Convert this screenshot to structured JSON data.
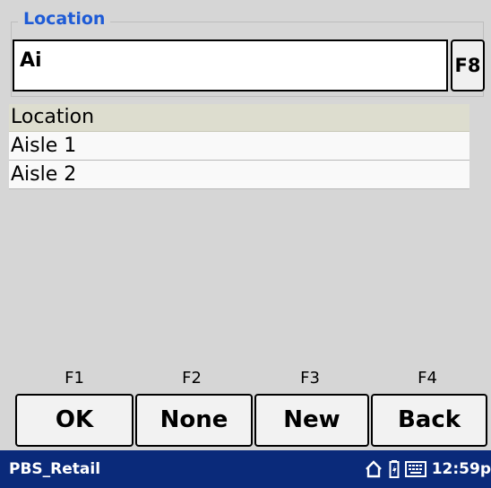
{
  "location_group": {
    "legend": "Location",
    "input_value": "Ai",
    "lookup_button": "F8"
  },
  "list": {
    "header": "Location",
    "items": [
      "Aisle 1",
      "Aisle 2"
    ]
  },
  "function_keys": {
    "labels": [
      "F1",
      "F2",
      "F3",
      "F4"
    ],
    "buttons": [
      "OK",
      "None",
      "New",
      "Back"
    ]
  },
  "taskbar": {
    "app_name": "PBS_Retail",
    "clock": "12:59p",
    "icons": [
      "home-icon",
      "battery-icon",
      "keyboard-icon"
    ],
    "background": "#0a2a7a"
  },
  "colors": {
    "accent": "#1e5bd6",
    "list_header_bg": "#ddddcf",
    "screen_bg": "#d6d6d6"
  }
}
